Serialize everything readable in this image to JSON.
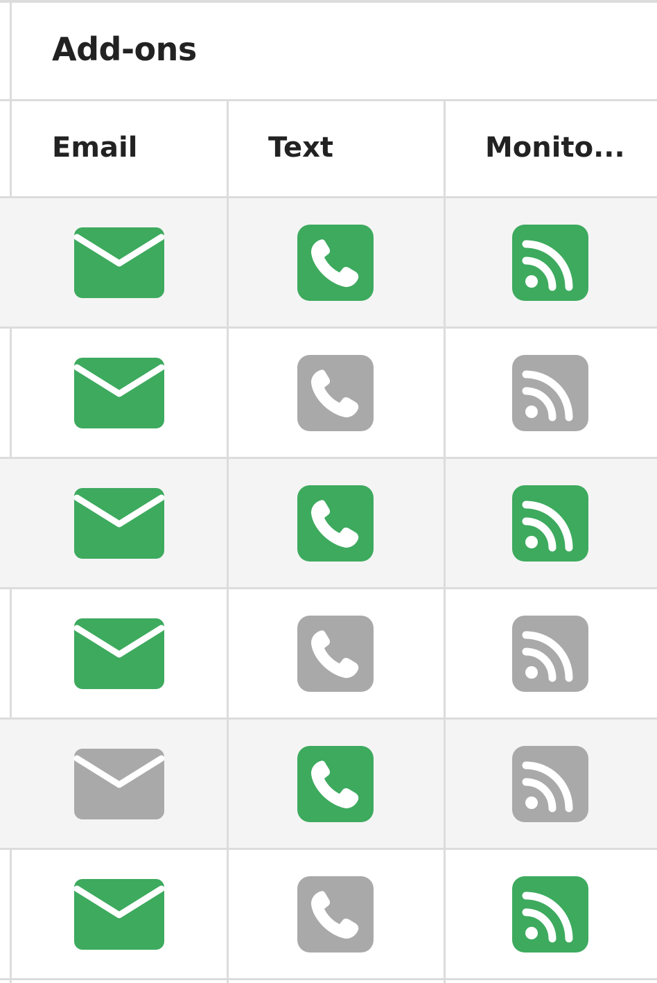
{
  "panel": {
    "title": "Add-ons"
  },
  "columns": [
    {
      "key": "email",
      "label": "Email"
    },
    {
      "key": "text",
      "label": "Text"
    },
    {
      "key": "monitor",
      "label": "Monito..."
    }
  ],
  "rows": [
    {
      "email": true,
      "text": true,
      "monitor": true
    },
    {
      "email": true,
      "text": false,
      "monitor": false
    },
    {
      "email": true,
      "text": true,
      "monitor": true
    },
    {
      "email": true,
      "text": false,
      "monitor": false
    },
    {
      "email": false,
      "text": true,
      "monitor": false
    },
    {
      "email": true,
      "text": false,
      "monitor": true
    }
  ],
  "icons": {
    "email": "envelope-icon",
    "text": "phone-icon",
    "monitor": "rss-icon"
  },
  "colors": {
    "enabled": "#3daa5e",
    "disabled": "#a9a9a9",
    "shaded_row": "#f4f4f4",
    "border": "#dcdcdc",
    "text": "#222222"
  }
}
